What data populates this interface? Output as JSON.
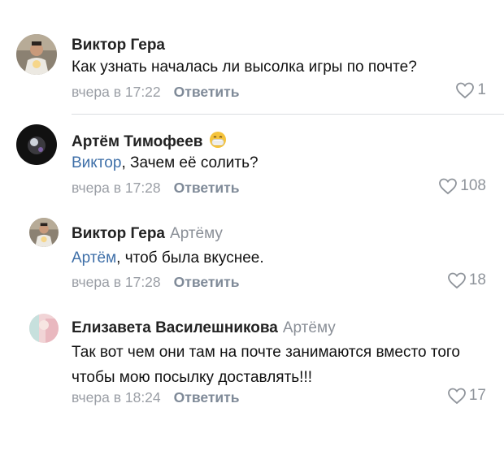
{
  "comments": [
    {
      "author": "Виктор Гера",
      "reply_to": "",
      "mention": "",
      "text": "Как узнать началась ли высолка игры по почте?",
      "time": "вчера в 17:22",
      "reply_label": "Ответить",
      "likes": "1"
    },
    {
      "author": "Артём Тимофеев",
      "reply_to": "",
      "mention": "Виктор",
      "text": ", Зачем её солить?",
      "time": "вчера в 17:28",
      "reply_label": "Ответить",
      "likes": "108"
    },
    {
      "author": "Виктор Гера",
      "reply_to": "Артёму",
      "mention": "Артём",
      "text": ", чтоб была вкуснее.",
      "time": "вчера в 17:28",
      "reply_label": "Ответить",
      "likes": "18"
    },
    {
      "author": "Елизавета Василешникова",
      "reply_to": "Артёму",
      "mention": "",
      "text": "Так вот чем они там на почте занимаются вместо того чтобы мою посылку доставлять!!!",
      "time": "вчера в 18:24",
      "reply_label": "Ответить",
      "likes": "17"
    }
  ],
  "colors": {
    "mention": "#3e6fa8",
    "meta": "#9a9ea5",
    "reply_button": "#7f8a98",
    "heart": "#8f949b"
  }
}
